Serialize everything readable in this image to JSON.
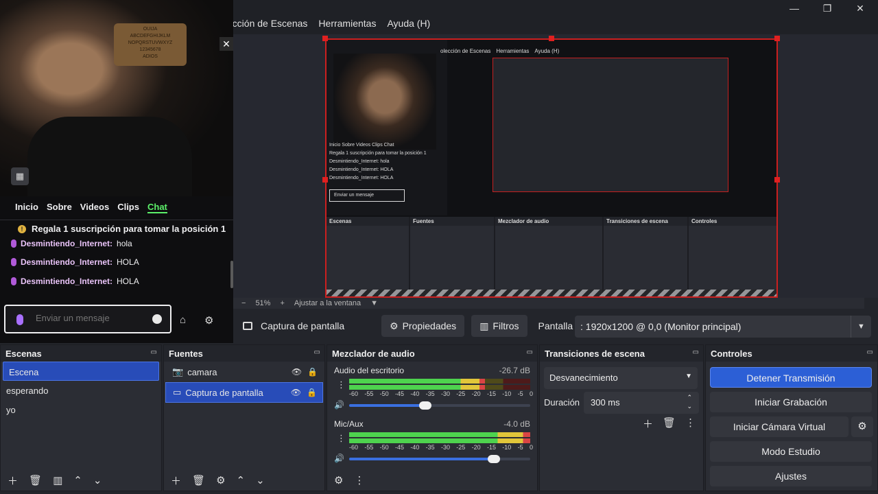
{
  "window": {
    "menu": [
      "olección de Escenas",
      "Herramientas",
      "Ayuda (H)"
    ],
    "controls": [
      "—",
      "❐",
      "✕"
    ]
  },
  "webcam": {
    "board_text": "OUIJA\nABCDEFGHIJKLM\nNOPQRSTUVWXYZ\n12345678\nADIOS",
    "close": "✕"
  },
  "chat": {
    "tabs": [
      "Inicio",
      "Sobre",
      "Videos",
      "Clips",
      "Chat"
    ],
    "promo": "Regala 1 suscripción para tomar la posición 1",
    "messages": [
      {
        "user": "Desmintiendo_Internet:",
        "text": "hola"
      },
      {
        "user": "Desmintiendo_Internet:",
        "text": "HOLA"
      },
      {
        "user": "Desmintiendo_Internet:",
        "text": "HOLA"
      }
    ],
    "input_placeholder": "Enviar un mensaje"
  },
  "preview_inner": {
    "menu": [
      "olección de Escenas",
      "Herramientas",
      "Ayuda (H)"
    ],
    "tabs": "Inicio  Sobre  Videos  Clips  Chat",
    "promo": "Regala 1 suscripción para tomar la posición 1",
    "line1": "Desmintiendo_Internet: hola",
    "line2": "Desmintiendo_Internet: HOLA",
    "line3": "Desmintiendo_Internet: HOLA",
    "placeholder": "Enviar un mensaje",
    "docks": [
      "Escenas",
      "Fuentes",
      "Mezclador de audio",
      "Transiciones de escena",
      "Controles"
    ]
  },
  "zoom": {
    "minus": "−",
    "value": "51%",
    "plus": "+",
    "fit": "Ajustar a la ventana",
    "arrow": "▼"
  },
  "source_toolbar": {
    "source_name": "Captura de pantalla",
    "properties": "Propiedades",
    "filters": "Filtros",
    "display_label": "Pantalla",
    "display_value": ": 1920x1200 @ 0,0 (Monitor principal)"
  },
  "scenes": {
    "title": "Escenas",
    "items": [
      "Escena",
      "esperando",
      "yo"
    ],
    "selected": 0
  },
  "sources": {
    "title": "Fuentes",
    "items": [
      "camara",
      "Captura de pantalla"
    ],
    "selected": 1
  },
  "mixer": {
    "title": "Mezclador de audio",
    "channels": [
      {
        "name": "Audio del escritorio",
        "db": "-26.7 dB",
        "level": 0.75,
        "volume": 0.42
      },
      {
        "name": "Mic/Aux",
        "db": "-4.0 dB",
        "level": 1.0,
        "volume": 0.8
      }
    ],
    "ticks": [
      "-60",
      "-55",
      "-50",
      "-45",
      "-40",
      "-35",
      "-30",
      "-25",
      "-20",
      "-15",
      "-10",
      "-5",
      "0"
    ]
  },
  "transitions": {
    "title": "Transiciones de escena",
    "selected": "Desvanecimiento",
    "duration_label": "Duración",
    "duration_value": "300 ms"
  },
  "controls": {
    "title": "Controles",
    "buttons": [
      "Detener Transmisión",
      "Iniciar Grabación",
      "Iniciar Cámara Virtual",
      "Modo Estudio",
      "Ajustes"
    ]
  },
  "colors": {
    "accent": "#284cb8",
    "selection_border": "#cc1f1f",
    "chat_active": "#5cf16a"
  }
}
